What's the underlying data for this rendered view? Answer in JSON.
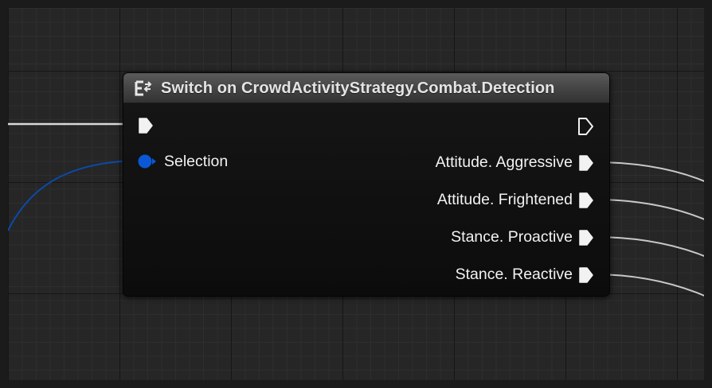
{
  "node": {
    "title": "Switch on CrowdActivityStrategy.Combat.Detection",
    "icon": "switch-enum-icon",
    "header_color": "#4a4a4a",
    "input_pins": {
      "exec": {
        "type": "exec",
        "connected": true
      },
      "selection": {
        "label": "Selection",
        "type": "enum",
        "color": "#0b58d6",
        "connected": true
      }
    },
    "output_pins": {
      "default_exec": {
        "type": "exec",
        "connected": false
      },
      "cases": [
        {
          "label": "Attitude. Aggressive",
          "connected": true
        },
        {
          "label": "Attitude. Frightened",
          "connected": true
        },
        {
          "label": "Stance. Proactive",
          "connected": true
        },
        {
          "label": "Stance. Reactive",
          "connected": true
        }
      ]
    }
  },
  "colors": {
    "canvas_background": "#262626",
    "exec_wire": "#d8d8d8",
    "enum_wire": "#0b4aa8"
  }
}
